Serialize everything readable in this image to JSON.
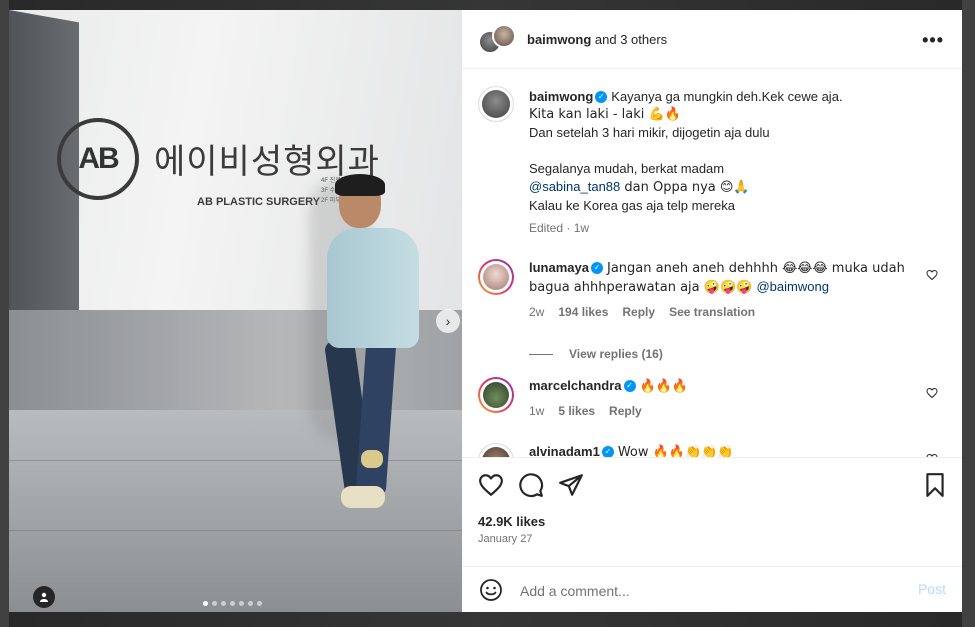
{
  "photo": {
    "sign_korean": "에이비성형외과",
    "sign_logo": "AB",
    "sign_english": "AB PLASTIC SURGERY",
    "sign_directory": [
      "4F 진료예약",
      "3F 수술실·상담실",
      "2F 피부과"
    ],
    "carousel": {
      "total": 7,
      "active_index": 0
    }
  },
  "header": {
    "username": "baimwong",
    "others": "and 3 others"
  },
  "caption": {
    "username": "baimwong",
    "lines": [
      "Kayanya ga mungkin deh.Kek cewe aja.",
      "Kita kan laki - laki 💪🔥",
      "Dan setelah 3 hari mikir, dijogetin aja dulu",
      "",
      "Segalanya mudah, berkat madam",
      "@sabina_tan88",
      " dan Oppa nya 😊🙏",
      "Kalau ke Korea gas aja telp mereka"
    ],
    "meta": "Edited · 1w"
  },
  "comments": [
    {
      "username": "lunamaya",
      "verified": true,
      "text_a": "Jangan aneh aneh dehhhh 😂😂😂 muka udah",
      "text_b": "bagua ahhhperawatan aja 🤪🤪🤪 ",
      "mention": "@baimwong",
      "time": "2w",
      "likes": "194 likes",
      "reply": "Reply",
      "translate": "See translation",
      "view_replies": "View replies (16)"
    },
    {
      "username": "marcelchandra",
      "verified": true,
      "text": "🔥🔥🔥",
      "time": "1w",
      "likes": "5 likes",
      "reply": "Reply"
    },
    {
      "username": "alvinadam1",
      "verified": true,
      "text": "Wow 🔥🔥👏👏👏"
    }
  ],
  "post": {
    "likes": "42.9K likes",
    "date": "January 27"
  },
  "add_comment": {
    "placeholder": "Add a comment...",
    "post_label": "Post"
  },
  "colors": {
    "verified": "#0095f6",
    "link": "#00376b",
    "post_disabled": "#b3dbff",
    "muted": "#737373"
  }
}
